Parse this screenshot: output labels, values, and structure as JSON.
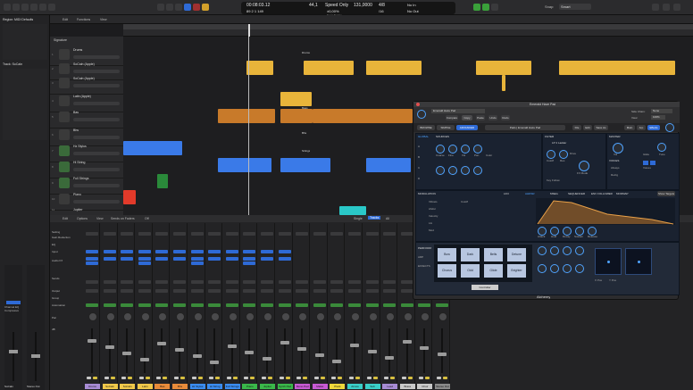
{
  "toolbar": {
    "position": "00:08:03.12",
    "bars": "89  2  1  149",
    "tempo": "44,1",
    "tempo_mode": "Speed Only",
    "speed_pct": "±0,00%",
    "keep_tempo": "Keep Tempo",
    "samples": "131,0000",
    "sig": "4/8",
    "key": "/16",
    "out": "No Out",
    "in": "No In",
    "snap_label": "Snap:",
    "snap_value": "Smart"
  },
  "inspector": {
    "region_label": "Region: MIDI Defaults",
    "track_label": "Track: SoCaln",
    "strip_names": [
      "SoCaln",
      "Stereo Out"
    ],
    "channel_eq": "Channel EQ",
    "compressor": "Compressor"
  },
  "tracks_bar": {
    "edit": "Edit",
    "functions": "Functions",
    "view": "View"
  },
  "arrange": {
    "signature_label": "Signature",
    "tracks": [
      {
        "num": "1",
        "name": "Drums"
      },
      {
        "num": "2",
        "name": "SoCaln (Apple)"
      },
      {
        "num": "3",
        "name": "SoCaln (Apple)"
      },
      {
        "num": "4",
        "name": "Latin (Apple)"
      },
      {
        "num": "5",
        "name": "Bas"
      },
      {
        "num": "6",
        "name": "Bhs"
      },
      {
        "num": "7",
        "name": "Hz Stylus"
      },
      {
        "num": "8",
        "name": "Hi String"
      },
      {
        "num": "9",
        "name": "Full Strings"
      },
      {
        "num": "10",
        "name": "Piano"
      },
      {
        "num": "11",
        "name": "Jupiter"
      }
    ],
    "markers": [
      "Drums",
      "Bass",
      "Bhs",
      "Strings"
    ]
  },
  "mixer": {
    "menu": [
      "Edit",
      "Options",
      "View",
      "Sends on Faders",
      "Off"
    ],
    "tabs": [
      "Single",
      "Tracks",
      "All"
    ],
    "row_labels": [
      "Setting",
      "Gain Reduction",
      "EQ",
      "Input",
      "Audio FX",
      "Sends",
      "Output",
      "Group",
      "Automation",
      "Pan",
      "dB"
    ],
    "strip_names": [
      "Drums",
      "SoCaln",
      "SoCaln",
      "Latin",
      "Bas",
      "Bhs",
      "Hz Stylus",
      "Hi String",
      "Full Strings",
      "Piano",
      "Jupiter",
      "Synth Pad",
      "Mono Pad",
      "Mallet",
      "Pluck",
      "Atmos",
      "Sub",
      "Lead",
      "Brass",
      "Choir",
      "Stereo Out"
    ],
    "strip_colors": [
      "#a78bd4",
      "#f0c84a",
      "#f0c84a",
      "#f0c84a",
      "#e88b3a",
      "#e88b3a",
      "#3a8cf0",
      "#3a8cf0",
      "#3a8cf0",
      "#3ab84a",
      "#3ab84a",
      "#3ab84a",
      "#c85ad4",
      "#c85ad4",
      "#f0d83a",
      "#3acfc8",
      "#3acfc8",
      "#a78bd4",
      "#c8c8c8",
      "#c8c8c8",
      "#8a8a8a"
    ]
  },
  "plugin": {
    "title": "Emerald Haze Pad",
    "header_items": [
      "Compare",
      "Copy",
      "Paste",
      "Undo",
      "Redo"
    ],
    "view_label": "View:",
    "view_value": "100%",
    "side_chain_label": "Side Chain:",
    "side_chain_value": "None",
    "tabs": [
      "BROWSE",
      "SIMPLE",
      "ADVANCED"
    ],
    "preset": "Pads | Emerald Haze Pad",
    "preset_buttons": [
      "File",
      "Edit",
      "Save As"
    ],
    "view_btns": [
      "Main",
      "Arp",
      "Effects"
    ],
    "sections": {
      "global": "GLOBAL",
      "sources": "SOURCES",
      "filter": "FILTER",
      "master": "MASTER",
      "voices": "VOICES",
      "modulation": "MODULATION",
      "perform": "PERFORM",
      "arp": "ARP",
      "effects": "EFFECTS"
    },
    "source_rows": [
      "A",
      "B",
      "C",
      "D"
    ],
    "source_knob_labels": [
      "Coarse",
      "Fine",
      "Vol",
      "Pan",
      "Color"
    ],
    "filter_labels": [
      "LP 2 Ladder",
      "Cutoff",
      "Res",
      "Drive",
      "FX Mode",
      "Key Follow"
    ],
    "master_labels": [
      "Vol",
      "Glide",
      "Tune"
    ],
    "voices_labels": [
      "Always",
      "Retrig",
      "Voices"
    ],
    "mod_tabs": [
      "LFO",
      "AHDSR",
      "MSEG",
      "SEQUENCER",
      "ENV FOLLOWER",
      "MODMAP"
    ],
    "mod_targets": [
      "Vibrato",
      "Ahdsr",
      "Velocity",
      "Lfo",
      "Mod",
      "Cutoff"
    ],
    "env_labels": [
      "Attack",
      "Hold",
      "Decay",
      "Sustain",
      "Release"
    ],
    "env_values": [
      "0,50",
      "0,4",
      "0,9",
      "0,5",
      "Mod"
    ],
    "show_targets": "Show Targets",
    "pads": [
      "Bow",
      "Dark",
      "Bells",
      "Detune",
      "Chorus",
      "Odd",
      "Glide",
      "Brighter"
    ],
    "controller": "Controller",
    "xy_labels": [
      "X Pos",
      "Y Pos"
    ],
    "footer": "Alchemy"
  },
  "colors": {
    "yellow": "#e8b43a",
    "orange": "#c87a2a",
    "blue": "#3a7ae8",
    "red": "#e23a2a",
    "green": "#2a8a3a",
    "cyan": "#2ac8c8",
    "accent": "#4fa3ff"
  }
}
